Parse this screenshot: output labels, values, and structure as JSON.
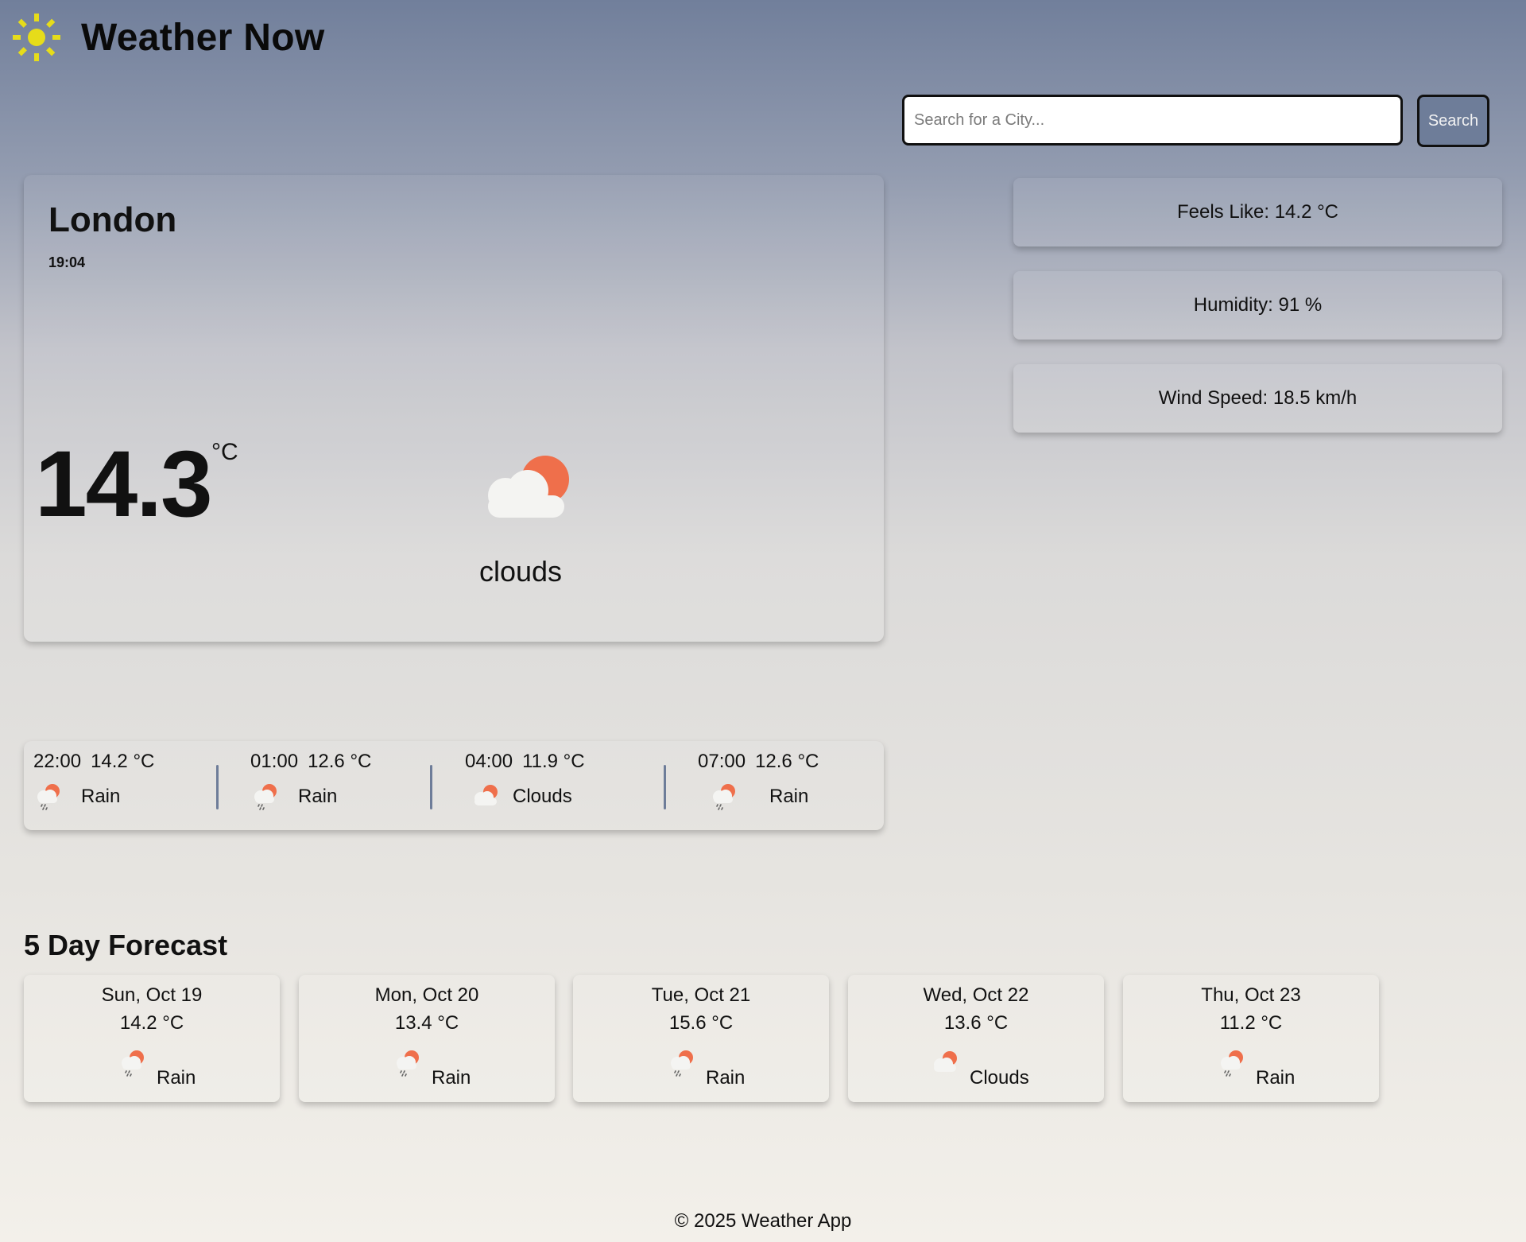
{
  "app": {
    "title": "Weather Now",
    "logo_icon": "sun-icon",
    "logo_color": "#e6dc1a"
  },
  "search": {
    "placeholder": "Search for a City...",
    "value": "",
    "button_label": "Search"
  },
  "current": {
    "city": "London",
    "time": "19:04",
    "temperature": "14.3",
    "unit": "°C",
    "condition": "clouds",
    "icon": "cloud-sun-icon"
  },
  "stats": {
    "feels_like": "Feels Like: 14.2 °C",
    "humidity": "Humidity: 91 %",
    "wind_speed": "Wind Speed: 18.5 km/h"
  },
  "hourly": [
    {
      "time": "22:00",
      "temp": "14.2 °C",
      "condition": "Rain",
      "icon": "rain-icon"
    },
    {
      "time": "01:00",
      "temp": "12.6 °C",
      "condition": "Rain",
      "icon": "rain-icon"
    },
    {
      "time": "04:00",
      "temp": "11.9 °C",
      "condition": "Clouds",
      "icon": "cloud-icon"
    },
    {
      "time": "07:00",
      "temp": "12.6 °C",
      "condition": "Rain",
      "icon": "rain-icon"
    }
  ],
  "forecast": {
    "heading": "5 Day Forecast",
    "days": [
      {
        "date": "Sun, Oct 19",
        "temp": "14.2 °C",
        "condition": "Rain",
        "icon": "rain-icon"
      },
      {
        "date": "Mon, Oct 20",
        "temp": "13.4 °C",
        "condition": "Rain",
        "icon": "rain-icon"
      },
      {
        "date": "Tue, Oct 21",
        "temp": "15.6 °C",
        "condition": "Rain",
        "icon": "rain-icon"
      },
      {
        "date": "Wed, Oct 22",
        "temp": "13.6 °C",
        "condition": "Clouds",
        "icon": "cloud-icon"
      },
      {
        "date": "Thu, Oct 23",
        "temp": "11.2 °C",
        "condition": "Rain",
        "icon": "rain-icon"
      }
    ]
  },
  "footer": {
    "text": "© 2025 Weather App"
  },
  "colors": {
    "accent": "#6e7d99",
    "sun_orange": "#ef6f4b",
    "cloud_white": "#f4f4f2"
  }
}
